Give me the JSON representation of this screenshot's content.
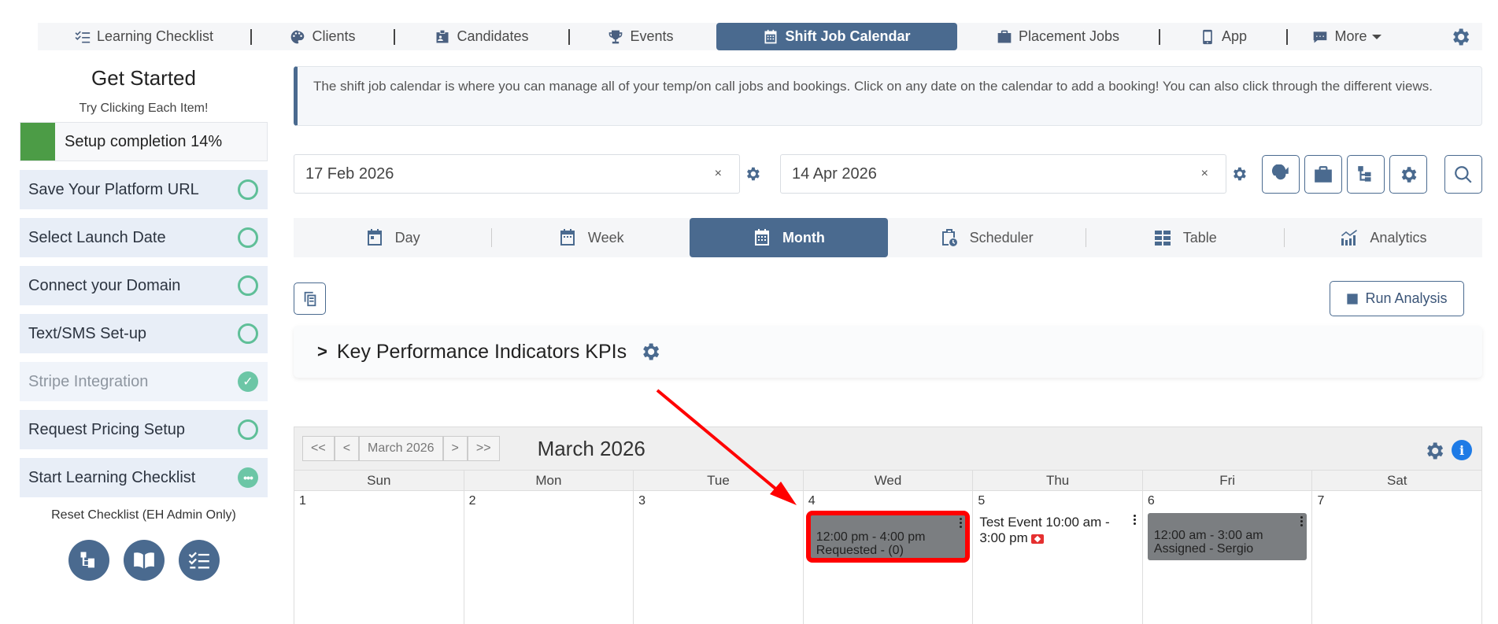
{
  "nav": {
    "items": [
      {
        "label": "Learning Checklist",
        "icon": "checklist-icon"
      },
      {
        "label": "Clients",
        "icon": "palette-icon"
      },
      {
        "label": "Candidates",
        "icon": "id-card-icon"
      },
      {
        "label": "Events",
        "icon": "trophy-icon"
      },
      {
        "label": "Shift Job Calendar",
        "icon": "calendar-icon",
        "active": true
      },
      {
        "label": "Placement Jobs",
        "icon": "briefcase-icon"
      },
      {
        "label": "App",
        "icon": "mobile-icon"
      },
      {
        "label": "More",
        "icon": "chat-icon"
      }
    ]
  },
  "sidebar": {
    "title": "Get Started",
    "subtitle": "Try Clicking Each Item!",
    "progress_label": "Setup completion 14%",
    "progress_pct": 14,
    "items": [
      {
        "label": "Save Your Platform URL",
        "status": "open"
      },
      {
        "label": "Select Launch Date",
        "status": "open"
      },
      {
        "label": "Connect your Domain",
        "status": "open"
      },
      {
        "label": "Text/SMS Set-up",
        "status": "open"
      },
      {
        "label": "Stripe Integration",
        "status": "done"
      },
      {
        "label": "Request Pricing Setup",
        "status": "open"
      },
      {
        "label": "Start Learning Checklist",
        "status": "in-progress"
      }
    ],
    "reset_label": "Reset Checklist (EH Admin Only)"
  },
  "info_text": "The shift job calendar is where you can manage all of your temp/on call jobs and bookings. Click on any date on the calendar to add a booking! You can also click through the different views.",
  "filters": {
    "start_date": "17 Feb 2026",
    "end_date": "14 Apr 2026",
    "clear_glyph": "×"
  },
  "views": [
    {
      "label": "Day",
      "icon": "calendar-day-icon"
    },
    {
      "label": "Week",
      "icon": "calendar-week-icon"
    },
    {
      "label": "Month",
      "icon": "calendar-month-icon",
      "active": true
    },
    {
      "label": "Scheduler",
      "icon": "clipboard-clock-icon"
    },
    {
      "label": "Table",
      "icon": "table-icon"
    },
    {
      "label": "Analytics",
      "icon": "chart-icon"
    }
  ],
  "run_analysis_label": "Run Analysis",
  "kpi": {
    "chevron": ">",
    "title": "Key Performance Indicators KPIs"
  },
  "calendar": {
    "nav": [
      "<<",
      "<",
      "March 2026",
      ">",
      ">>"
    ],
    "title": "March 2026",
    "info_glyph": "i",
    "weekdays": [
      "Sun",
      "Mon",
      "Tue",
      "Wed",
      "Thu",
      "Fri",
      "Sat"
    ],
    "days": [
      "1",
      "2",
      "3",
      "4",
      "5",
      "6",
      "7"
    ],
    "events": {
      "wed": {
        "line1": "12:00 pm - 4:00 pm",
        "line2": "Requested -  (0)"
      },
      "thu": {
        "text": "Test Event 10:00 am - 3:00 pm"
      },
      "fri": {
        "line1": "12:00 am - 3:00 am",
        "line2": "Assigned - Sergio"
      }
    }
  },
  "colors": {
    "primary": "#4a6a8f",
    "success": "#4c9c46",
    "highlight": "#ff0000",
    "event_bg": "#7b7e81"
  }
}
